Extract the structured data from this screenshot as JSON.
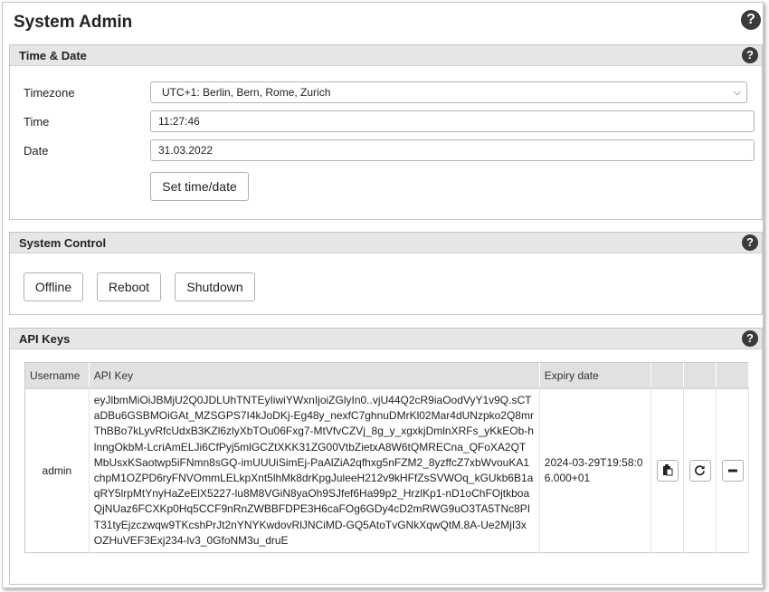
{
  "page": {
    "title": "System Admin",
    "help": "?"
  },
  "time_date": {
    "title": "Time & Date",
    "help": "?",
    "timezone_label": "Timezone",
    "timezone_value": "UTC+1: Berlin, Bern, Rome, Zurich",
    "time_label": "Time",
    "time_value": "11:27:46",
    "date_label": "Date",
    "date_value": "31.03.2022",
    "set_button": "Set time/date"
  },
  "system_control": {
    "title": "System Control",
    "help": "?",
    "offline_button": "Offline",
    "reboot_button": "Reboot",
    "shutdown_button": "Shutdown"
  },
  "api_keys": {
    "title": "API Keys",
    "help": "?",
    "columns": [
      "Username",
      "API Key",
      "Expiry date"
    ],
    "rows": [
      {
        "username": "admin",
        "api_key": "eyJlbmMiOiJBMjU2Q0JDLUhTNTEyIiwiYWxnIjoiZGlyIn0..vjU44Q2cR9iaOodVyY1v9Q.sCTaDBu6GSBMOiGAt_MZSGPS7I4kJoDKj-Eg48y_nexfC7ghnuDMrKl02Mar4dUNzpko2Q8mrThBBo7kLyvRfcUdxB3KZl6zlyXbTOu06Fxg7-MtVfvCZVj_8g_y_xgxkjDmlnXRFs_yKkEOb-hlnngOkbM-LcriAmELJi6CfPyj5mlGCZtXKK31ZG00VtbZietxA8W6tQMRECna_QFoXA2QTMbUsxKSaotwp5iFNmn8sGQ-imUUUiSimEj-PaAlZiA2qfhxg5nFZM2_8yzffcZ7xbWvouKA1chpM1OZPD6ryFNVOmmLELkpXnt5lhMk8drKpgJuleeH212v9kHFfZsSVWOq_kGUkb6B1aqRY5lrpMtYnyHaZeElX5227-lu8M8VGiN8yaOh9SJfef6Ha99p2_HrzlKp1-nD1oChFOjtkboaQjNUaz6FCXKp0Hq5CCF9nRnZWBBFDPE3H6caFOg6GDy4cD2mRWG9uO3TA5TNc8PIT31tyEjzczwqw9TKcshPrJt2nYNYKwdovRlJNCiMD-GQ5AtoTvGNkXqwQtM.8A-Ue2MjI3xOZHuVEF3Exj234-lv3_0GfoNM3u_druE",
        "expiry": "2024-03-29T19:58:06.000+01"
      }
    ],
    "actions": {
      "copy": "copy-icon",
      "renew": "refresh-icon",
      "delete": "minus-icon"
    }
  }
}
